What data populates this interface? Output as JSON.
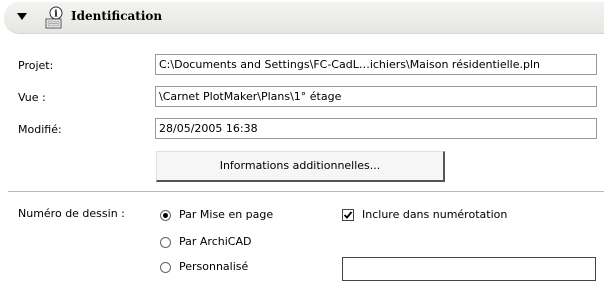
{
  "section": {
    "title": "Identification",
    "icons": {
      "toggle": "triangle-down-icon",
      "info": "info-document-icon"
    }
  },
  "fields": {
    "project": {
      "label": "Projet:",
      "value": "C:\\Documents and Settings\\FC-CadL…ichiers\\Maison résidentielle.pln"
    },
    "view": {
      "label": "Vue :",
      "value": "\\Carnet PlotMaker\\Plans\\1° étage"
    },
    "modified": {
      "label": "Modifié:",
      "value": "28/05/2005 16:38"
    }
  },
  "more_info_button": "Informations additionnelles...",
  "drawing_number": {
    "label": "Numéro de dessin :",
    "options": [
      {
        "label": "Par Mise en page",
        "selected": true
      },
      {
        "label": "Par ArchiCAD",
        "selected": false
      },
      {
        "label": "Personnalisé",
        "selected": false
      }
    ],
    "include_checkbox": {
      "label": "Inclure dans numérotation",
      "checked": true
    },
    "custom_value": ""
  }
}
